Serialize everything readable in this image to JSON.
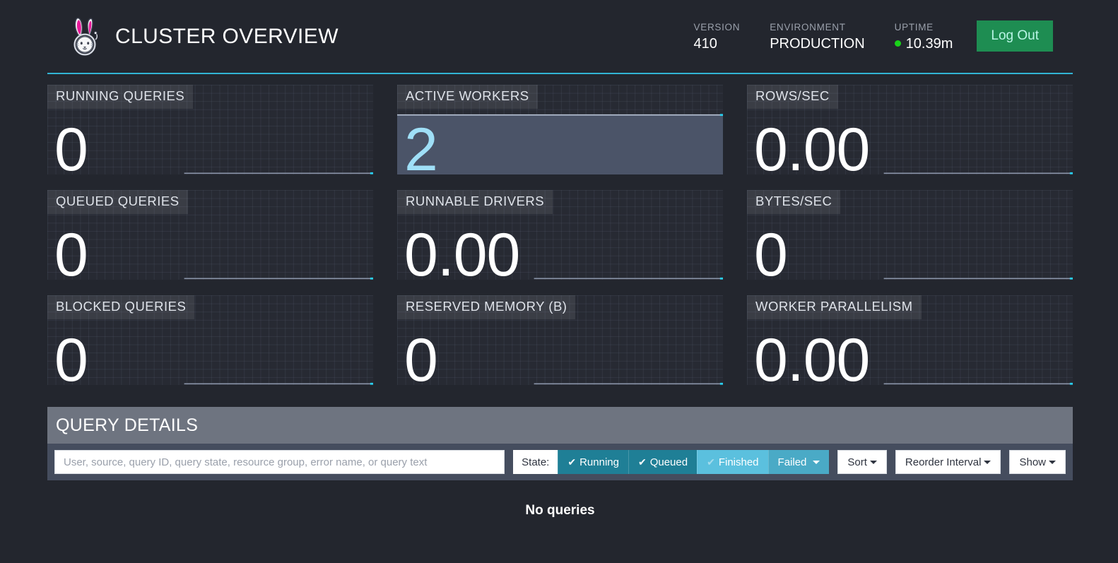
{
  "header": {
    "logo_icon": "trino-bunny-astronaut-logo",
    "title": "CLUSTER OVERVIEW",
    "meta": [
      {
        "label": "VERSION",
        "value": "410",
        "dot": false
      },
      {
        "label": "ENVIRONMENT",
        "value": "PRODUCTION",
        "dot": false
      },
      {
        "label": "UPTIME",
        "value": "10.39m",
        "dot": true
      }
    ],
    "logout_label": "Log Out",
    "accent_rule_color": "#31b4d4",
    "logout_bg": "#1e8d52",
    "status_dot_color": "#19d219"
  },
  "stats": [
    {
      "label": "RUNNING QUERIES",
      "value": "0",
      "highlight": false
    },
    {
      "label": "ACTIVE WORKERS",
      "value": "2",
      "highlight": true
    },
    {
      "label": "ROWS/SEC",
      "value": "0.00",
      "highlight": false
    },
    {
      "label": "QUEUED QUERIES",
      "value": "0",
      "highlight": false
    },
    {
      "label": "RUNNABLE DRIVERS",
      "value": "0.00",
      "highlight": false
    },
    {
      "label": "BYTES/SEC",
      "value": "0",
      "highlight": false
    },
    {
      "label": "BLOCKED QUERIES",
      "value": "0",
      "highlight": false
    },
    {
      "label": "RESERVED MEMORY (B)",
      "value": "0",
      "highlight": false
    },
    {
      "label": "WORKER PARALLELISM",
      "value": "0.00",
      "highlight": false
    }
  ],
  "chart_data": [
    {
      "type": "line",
      "title": "RUNNING QUERIES",
      "x": [
        0,
        1,
        2,
        3,
        4,
        5,
        6,
        7,
        8,
        9,
        10,
        11
      ],
      "values": [
        0,
        0,
        0,
        0,
        0,
        0,
        0,
        0,
        0,
        0,
        0,
        0
      ],
      "ylim": [
        0,
        1
      ],
      "last_point": 0,
      "grid": true,
      "line_color": "#8a94a8",
      "marker_color": "#2ad0f0"
    },
    {
      "type": "area",
      "title": "ACTIVE WORKERS",
      "x": [
        0,
        1,
        2,
        3,
        4,
        5,
        6,
        7,
        8,
        9,
        10,
        11
      ],
      "values": [
        2,
        2,
        2,
        2,
        2,
        2,
        2,
        2,
        2,
        2,
        2,
        2
      ],
      "ylim": [
        0,
        2
      ],
      "last_point": 2,
      "grid": true,
      "line_color": "#b9c4d6",
      "fill_color": "#4b5468",
      "marker_color": "#2ad0f0"
    },
    {
      "type": "line",
      "title": "ROWS/SEC",
      "x": [
        0,
        1,
        2,
        3,
        4,
        5,
        6,
        7,
        8,
        9,
        10,
        11
      ],
      "values": [
        0,
        0,
        0,
        0,
        0,
        0,
        0,
        0,
        0,
        0,
        0,
        0
      ],
      "ylim": [
        0,
        1
      ],
      "last_point": 0,
      "grid": true,
      "line_color": "#8a94a8",
      "marker_color": "#2ad0f0"
    },
    {
      "type": "line",
      "title": "QUEUED QUERIES",
      "x": [
        0,
        1,
        2,
        3,
        4,
        5,
        6,
        7,
        8,
        9,
        10,
        11
      ],
      "values": [
        0,
        0,
        0,
        0,
        0,
        0,
        0,
        0,
        0,
        0,
        0,
        0
      ],
      "ylim": [
        0,
        1
      ],
      "last_point": 0,
      "grid": true,
      "line_color": "#8a94a8",
      "marker_color": "#2ad0f0"
    },
    {
      "type": "line",
      "title": "RUNNABLE DRIVERS",
      "x": [
        0,
        1,
        2,
        3,
        4,
        5,
        6,
        7,
        8,
        9,
        10,
        11
      ],
      "values": [
        0,
        0,
        0,
        0,
        0,
        0,
        0,
        0,
        0,
        0,
        0,
        0
      ],
      "ylim": [
        0,
        1
      ],
      "last_point": 0,
      "grid": true,
      "line_color": "#8a94a8",
      "marker_color": "#2ad0f0"
    },
    {
      "type": "line",
      "title": "BYTES/SEC",
      "x": [
        0,
        1,
        2,
        3,
        4,
        5,
        6,
        7,
        8,
        9,
        10,
        11
      ],
      "values": [
        0,
        0,
        0,
        0,
        0,
        0,
        0,
        0,
        0,
        0,
        0,
        0
      ],
      "ylim": [
        0,
        1
      ],
      "last_point": 0,
      "grid": true,
      "line_color": "#8a94a8",
      "marker_color": "#2ad0f0"
    },
    {
      "type": "line",
      "title": "BLOCKED QUERIES",
      "x": [
        0,
        1,
        2,
        3,
        4,
        5,
        6,
        7,
        8,
        9,
        10,
        11
      ],
      "values": [
        0,
        0,
        0,
        0,
        0,
        0,
        0,
        0,
        0,
        0,
        0,
        0
      ],
      "ylim": [
        0,
        1
      ],
      "last_point": 0,
      "grid": true,
      "line_color": "#8a94a8",
      "marker_color": "#2ad0f0"
    },
    {
      "type": "line",
      "title": "RESERVED MEMORY (B)",
      "x": [
        0,
        1,
        2,
        3,
        4,
        5,
        6,
        7,
        8,
        9,
        10,
        11
      ],
      "values": [
        0,
        0,
        0,
        0,
        0,
        0,
        0,
        0,
        0,
        0,
        0,
        0
      ],
      "ylim": [
        0,
        1
      ],
      "last_point": 0,
      "grid": true,
      "line_color": "#8a94a8",
      "marker_color": "#2ad0f0"
    },
    {
      "type": "line",
      "title": "WORKER PARALLELISM",
      "x": [
        0,
        1,
        2,
        3,
        4,
        5,
        6,
        7,
        8,
        9,
        10,
        11
      ],
      "values": [
        0,
        0,
        0,
        0,
        0,
        0,
        0,
        0,
        0,
        0,
        0,
        0
      ],
      "ylim": [
        0,
        1
      ],
      "last_point": 0,
      "grid": true,
      "line_color": "#8a94a8",
      "marker_color": "#2ad0f0"
    }
  ],
  "query_details": {
    "title": "QUERY DETAILS",
    "search_placeholder": "User, source, query ID, query state, resource group, error name, or query text",
    "search_value": "",
    "state_label": "State:",
    "state_filters": [
      {
        "label": "Running",
        "checked": true,
        "style": "s-running",
        "caret": false
      },
      {
        "label": "Queued",
        "checked": true,
        "style": "s-queued",
        "caret": false
      },
      {
        "label": "Finished",
        "checked": true,
        "style": "s-finished",
        "caret": false
      },
      {
        "label": "Failed",
        "checked": false,
        "style": "s-failed",
        "caret": true
      }
    ],
    "dropdowns": [
      {
        "label": "Sort"
      },
      {
        "label": "Reorder Interval"
      },
      {
        "label": "Show"
      }
    ],
    "empty_message": "No queries"
  }
}
